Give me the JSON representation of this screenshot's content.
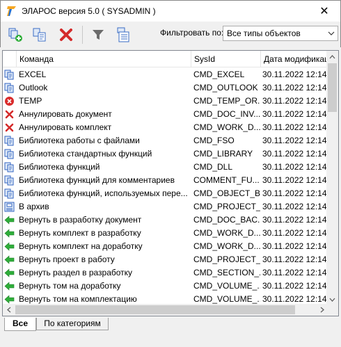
{
  "window": {
    "title": "ЭЛАРОС версия 5.0 ( SYSADMIN )",
    "close_glyph": "✕"
  },
  "toolbar": {
    "filter_label": "Фильтровать по:",
    "filter_value": "Все типы объектов"
  },
  "table": {
    "columns": [
      "Команда",
      "SysId",
      "Дата модификац"
    ],
    "rows": [
      {
        "icon": "blue-command-icon",
        "name": "EXCEL",
        "sysid": "CMD_EXCEL",
        "date": "30.11.2022 12:14"
      },
      {
        "icon": "blue-command-icon",
        "name": "Outlook",
        "sysid": "CMD_OUTLOOK",
        "date": "30.11.2022 12:14"
      },
      {
        "icon": "red-circle-x-icon",
        "name": "TEMP",
        "sysid": "CMD_TEMP_OR...",
        "date": "30.11.2022 12:14"
      },
      {
        "icon": "red-x-icon",
        "name": "Аннулировать документ",
        "sysid": "CMD_DOC_INV...",
        "date": "30.11.2022 12:14"
      },
      {
        "icon": "red-x-icon",
        "name": "Аннулировать комплект",
        "sysid": "CMD_WORK_D...",
        "date": "30.11.2022 12:14"
      },
      {
        "icon": "blue-command-icon",
        "name": "Библиотека работы с файлами",
        "sysid": "CMD_FSO",
        "date": "30.11.2022 12:14"
      },
      {
        "icon": "blue-command-icon",
        "name": "Библиотека стандартных функций",
        "sysid": "CMD_LIBRARY",
        "date": "30.11.2022 12:14"
      },
      {
        "icon": "blue-command-icon",
        "name": "Библиотека функций",
        "sysid": "CMD_DLL",
        "date": "30.11.2022 12:14"
      },
      {
        "icon": "blue-command-icon",
        "name": "Библиотека функций для комментариев",
        "sysid": "COMMENT_FU...",
        "date": "30.11.2022 12:14"
      },
      {
        "icon": "blue-command-icon",
        "name": "Библиотека функций, используемых пере...",
        "sysid": "CMD_OBJECT_B...",
        "date": "30.11.2022 12:14"
      },
      {
        "icon": "archive-icon",
        "name": "В архив",
        "sysid": "CMD_PROJECT_...",
        "date": "30.11.2022 12:14"
      },
      {
        "icon": "green-arrow-left-icon",
        "name": "Вернуть в разработку документ",
        "sysid": "CMD_DOC_BAC...",
        "date": "30.11.2022 12:14"
      },
      {
        "icon": "green-arrow-left-icon",
        "name": "Вернуть комплект в разработку",
        "sysid": "CMD_WORK_D...",
        "date": "30.11.2022 12:14"
      },
      {
        "icon": "green-arrow-left-icon",
        "name": "Вернуть комплект на доработку",
        "sysid": "CMD_WORK_D...",
        "date": "30.11.2022 12:14"
      },
      {
        "icon": "green-arrow-left-icon",
        "name": "Вернуть проект в работу",
        "sysid": "CMD_PROJECT_...",
        "date": "30.11.2022 12:14"
      },
      {
        "icon": "green-arrow-left-icon",
        "name": "Вернуть раздел в разработку",
        "sysid": "CMD_SECTION_...",
        "date": "30.11.2022 12:14"
      },
      {
        "icon": "green-arrow-left-icon",
        "name": "Вернуть том на доработку",
        "sysid": "CMD_VOLUME_...",
        "date": "30.11.2022 12:14"
      },
      {
        "icon": "green-arrow-left-icon",
        "name": "Вернуть том на комплектацию",
        "sysid": "CMD_VOLUME_...",
        "date": "30.11.2022 12:14"
      }
    ]
  },
  "tabs": [
    "Все",
    "По категориям"
  ],
  "active_tab": "Все"
}
